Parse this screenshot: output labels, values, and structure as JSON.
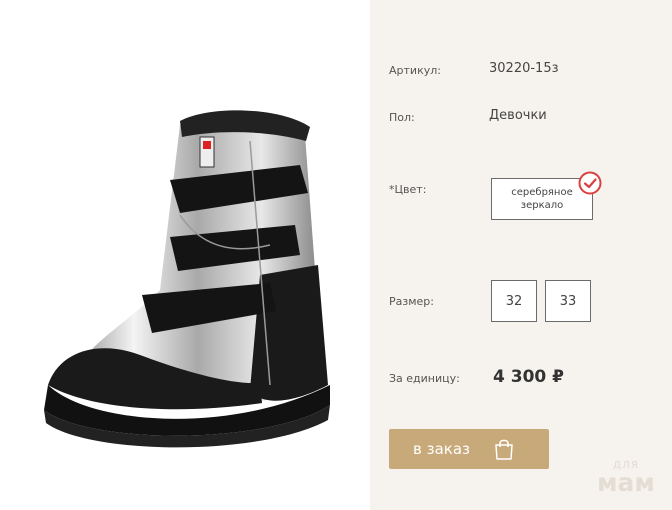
{
  "product": {
    "article_label": "Артикул:",
    "article_value": "30220-15з",
    "gender_label": "Пол:",
    "gender_value": "Девочки",
    "color_label": "*Цвет:",
    "color_option": "серебряное\nзеркало",
    "size_label": "Размер:",
    "sizes": [
      "32",
      "33"
    ],
    "price_label": "За единицу:",
    "price": "4 300 ₽"
  },
  "actions": {
    "order_label": "в заказ"
  },
  "watermark": {
    "top": "для",
    "bottom": "мам"
  },
  "colors": {
    "panel_bg": "#f6f3ee",
    "button_bg": "#c8a97a",
    "check_red": "#d94040",
    "boot_silver": "#c9c9c9",
    "boot_black": "#1a1a1a"
  },
  "icons": {
    "color_selected": "check-circle-icon",
    "order": "shopping-bag-icon"
  }
}
